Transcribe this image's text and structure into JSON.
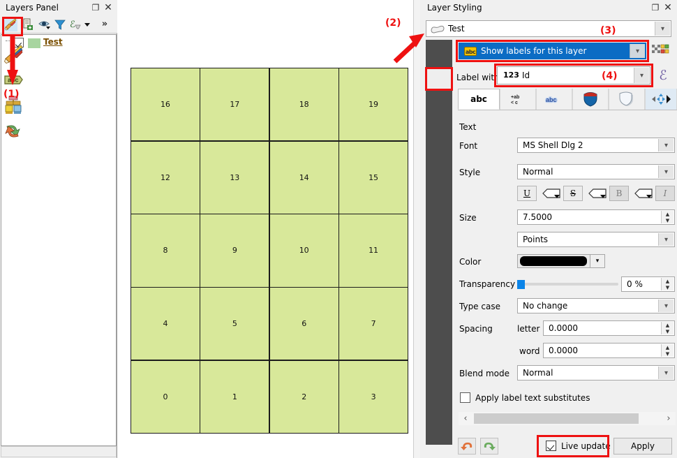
{
  "layers_panel": {
    "title": "Layers Panel",
    "window_buttons": [
      {
        "name": "float",
        "glyph": "❐"
      },
      {
        "name": "close",
        "glyph": "✕"
      }
    ],
    "toolbar_icons": [
      {
        "name": "open-layer-styling-panel-icon",
        "highlighted": true
      },
      {
        "name": "add-group-icon"
      },
      {
        "name": "manage-map-themes-icon"
      },
      {
        "name": "filter-legend-icon"
      },
      {
        "name": "expression-filter-icon"
      },
      {
        "name": "dropdown-arrow-icon"
      },
      {
        "name": "more-chevrons-icon",
        "glyph": "»"
      }
    ],
    "layer": {
      "name": "Test",
      "checked": true,
      "swatch_color": "#a8d5a0"
    }
  },
  "map": {
    "cells": [
      "16",
      "17",
      "18",
      "19",
      "12",
      "13",
      "14",
      "15",
      "8",
      "9",
      "10",
      "11",
      "4",
      "5",
      "6",
      "7",
      "0",
      "1",
      "2",
      "3"
    ],
    "fill_color": "#d8e89a",
    "stroke_color": "#1b1b1b"
  },
  "styling_panel": {
    "title": "Layer Styling",
    "window_buttons": [
      {
        "name": "float",
        "glyph": "❐"
      },
      {
        "name": "close",
        "glyph": "✕"
      }
    ],
    "layer_selector": {
      "value": "Test",
      "icon": "polygon-layer-icon"
    },
    "side_tabs": [
      {
        "name": "symbology-tab",
        "icon": "paintbrush-icon"
      },
      {
        "name": "labels-tab",
        "icon": "abc-label-icon",
        "selected": true
      },
      {
        "name": "sources-fields-tab",
        "icon": "brushes-icon"
      },
      {
        "name": "history-tab",
        "icon": "undo-redo-arrows-icon"
      }
    ],
    "labels_mode": {
      "value": "Show labels for this layer",
      "icon": "abc-badge-icon",
      "accent": "#0b6cc4"
    },
    "rendering_button": {
      "name": "checkerboard-icon"
    },
    "label_with": {
      "label": "Label with",
      "field_type": "123",
      "field_name": "Id"
    },
    "expression_button": {
      "glyph": "ℰ"
    },
    "tabs": [
      {
        "name": "text-tab",
        "label": "abc",
        "type": "text",
        "active": true
      },
      {
        "name": "formatting-tab",
        "label": "+ab\n< c",
        "type": "formatting"
      },
      {
        "name": "buffer-tab",
        "label": "abc",
        "type": "buffer"
      },
      {
        "name": "background-tab",
        "label": "",
        "type": "background"
      },
      {
        "name": "shadow-tab",
        "label": "",
        "type": "shadow"
      },
      {
        "name": "placement-tab",
        "label": "",
        "type": "placement"
      }
    ],
    "text_section": {
      "heading": "Text",
      "font": {
        "label": "Font",
        "value": "MS Shell Dlg 2"
      },
      "style": {
        "label": "Style",
        "value": "Normal"
      },
      "format_buttons": [
        {
          "name": "underline-button",
          "label": "U",
          "enabled": true
        },
        {
          "name": "underline-data-defined-button",
          "label": ""
        },
        {
          "name": "strikethrough-button",
          "label": "S",
          "enabled": true
        },
        {
          "name": "strikethrough-data-defined-button",
          "label": ""
        },
        {
          "name": "bold-button",
          "label": "B",
          "enabled": false
        },
        {
          "name": "bold-data-defined-button",
          "label": ""
        },
        {
          "name": "italic-button",
          "label": "I",
          "enabled": false
        }
      ],
      "size": {
        "label": "Size",
        "value": "7.5000"
      },
      "size_units": {
        "value": "Points"
      },
      "color": {
        "label": "Color",
        "value": "#000000"
      },
      "transparency": {
        "label": "Transparency",
        "value": "0 %",
        "percent": 0
      },
      "type_case": {
        "label": "Type case",
        "value": "No change"
      },
      "spacing": {
        "label": "Spacing",
        "letter_label": "letter",
        "letter_value": "0.0000",
        "word_label": "word",
        "word_value": "0.0000"
      },
      "blend_mode": {
        "label": "Blend mode",
        "value": "Normal"
      },
      "substitutes": {
        "label": "Apply label text substitutes",
        "checked": false
      }
    },
    "footer": {
      "undo_button": {
        "name": "undo-icon"
      },
      "redo_button": {
        "name": "redo-icon"
      },
      "live_update": {
        "label": "Live update",
        "checked": true
      },
      "apply_button": {
        "label": "Apply"
      }
    },
    "scroll": {
      "left_arrow": "‹",
      "right_arrow": "›"
    }
  },
  "annotations": [
    {
      "name": "annotation-1",
      "text": "(1)"
    },
    {
      "name": "annotation-2",
      "text": "(2)"
    },
    {
      "name": "annotation-3",
      "text": "(3)"
    },
    {
      "name": "annotation-4",
      "text": "(4)"
    }
  ],
  "accent_red": "#ee1111"
}
